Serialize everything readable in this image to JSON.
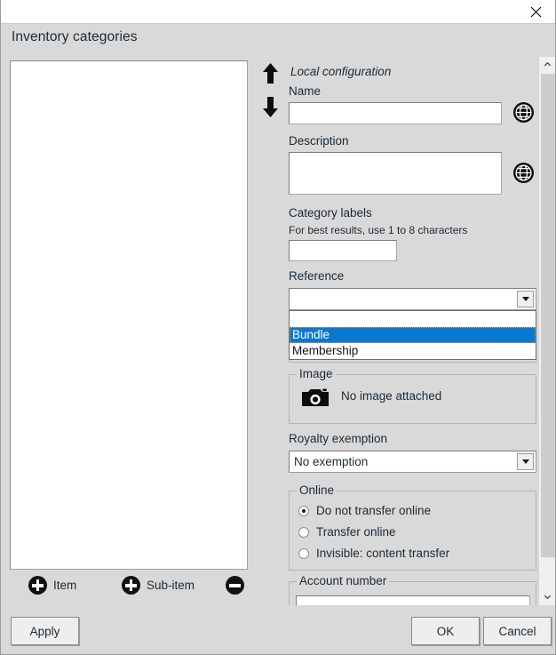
{
  "window": {
    "close_icon": "close-icon"
  },
  "dialog": {
    "title": "Inventory categories"
  },
  "tree": {
    "items": [],
    "move_up_icon": "arrow-up-icon",
    "move_down_icon": "arrow-down-icon",
    "actions": {
      "add_item_label": "Item",
      "add_subitem_label": "Sub-item",
      "remove_label": ""
    },
    "apply_label": "Apply"
  },
  "form": {
    "section_title": "Local configuration",
    "name": {
      "label": "Name",
      "value": "",
      "placeholder": "",
      "globe_icon": "globe-icon"
    },
    "description": {
      "label": "Description",
      "value": "",
      "placeholder": "",
      "globe_icon": "globe-icon"
    },
    "category_labels": {
      "label": "Category labels",
      "hint": "For best results, use 1 to 8 characters",
      "value": "",
      "placeholder": ""
    },
    "reference": {
      "label": "Reference",
      "value": "",
      "expanded": true,
      "options": [
        "",
        "Bundle",
        "Membership"
      ],
      "selected_index": 1,
      "caret_icon": "chevron-down-icon"
    },
    "image": {
      "legend": "Image",
      "status": "No image attached",
      "camera_icon": "camera-icon"
    },
    "royalty_exemption": {
      "label": "Royalty exemption",
      "value": "No exemption",
      "caret_icon": "chevron-down-icon"
    },
    "online": {
      "legend": "Online",
      "options": [
        {
          "label": "Do not transfer online",
          "checked": true
        },
        {
          "label": "Transfer online",
          "checked": false
        },
        {
          "label": "Invisible: content transfer",
          "checked": false
        }
      ]
    },
    "account_number": {
      "legend": "Account number",
      "value": "",
      "placeholder": ""
    }
  },
  "scrollbar": {
    "up_icon": "chevron-up-icon",
    "down_icon": "chevron-down-icon"
  },
  "footer": {
    "ok_label": "OK",
    "cancel_label": "Cancel"
  },
  "colors": {
    "dialog_bg": "#d9d9d9",
    "highlight": "#0a78d1",
    "text": "#1b2a36"
  }
}
